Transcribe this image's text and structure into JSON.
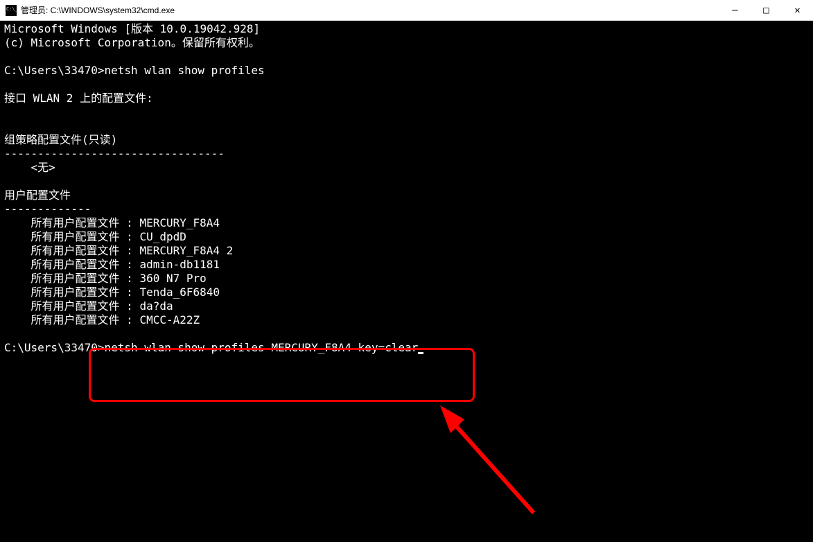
{
  "titlebar": {
    "text": "管理员: C:\\WINDOWS\\system32\\cmd.exe"
  },
  "controls": {
    "minimize": "—",
    "maximize": "□",
    "close": "✕"
  },
  "terminal": {
    "line1": "Microsoft Windows [版本 10.0.19042.928]",
    "line2": "(c) Microsoft Corporation。保留所有权利。",
    "blank1": "",
    "prompt1": "C:\\Users\\33470>",
    "cmd1": "netsh wlan show profiles",
    "blank2": "",
    "iface": "接口 WLAN 2 上的配置文件:",
    "blank3": "",
    "blank3b": "",
    "gp_header": "组策略配置文件(只读)",
    "gp_divider": "---------------------------------",
    "gp_none": "    <无>",
    "blank4": "",
    "user_header": "用户配置文件",
    "user_divider": "-------------",
    "profile1_label": "    所有用户配置文件 : ",
    "profile1_value": "MERCURY_F8A4",
    "profile2_label": "    所有用户配置文件 : ",
    "profile2_value": "CU_dpdD",
    "profile3_label": "    所有用户配置文件 : ",
    "profile3_value": "MERCURY_F8A4 2",
    "profile4_label": "    所有用户配置文件 : ",
    "profile4_value": "admin-db1181",
    "profile5_label": "    所有用户配置文件 : ",
    "profile5_value": "360 N7 Pro",
    "profile6_label": "    所有用户配置文件 : ",
    "profile6_value": "Tenda_6F6840",
    "profile7_label": "    所有用户配置文件 : ",
    "profile7_value": "da?da",
    "profile8_label": "    所有用户配置文件 : ",
    "profile8_value": "CMCC-A22Z",
    "blank5": "",
    "prompt2": "C:\\Users\\33470>",
    "cmd2": "netsh wlan show profiles MERCURY_F8A4 key=clear"
  },
  "annotation": {
    "highlight_color": "#ff0000",
    "arrow_color": "#ff0000"
  }
}
